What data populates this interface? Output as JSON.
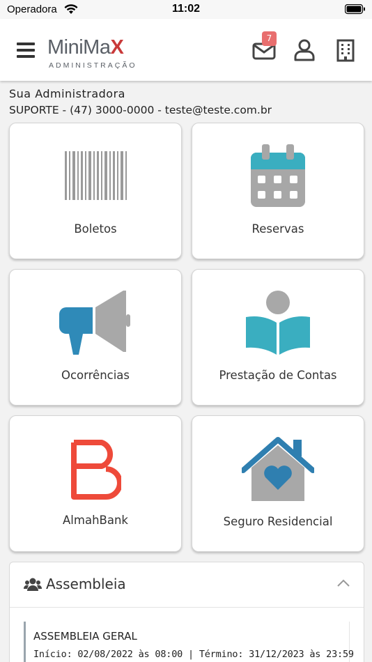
{
  "status_bar": {
    "carrier": "Operadora",
    "time": "11:02"
  },
  "header": {
    "logo_text_main": "MiniMa",
    "logo_text_x": "X",
    "logo_subtext": "ADMINISTRAÇÃO",
    "mail_badge": "7"
  },
  "admin": {
    "name": "Sua Administradora",
    "contact": "SUPORTE - (47) 3000-0000 - teste@teste.com.br"
  },
  "tiles": [
    {
      "label": "Boletos",
      "icon": "barcode-icon"
    },
    {
      "label": "Reservas",
      "icon": "calendar-icon"
    },
    {
      "label": "Ocorrências",
      "icon": "megaphone-icon"
    },
    {
      "label": "Prestação de Contas",
      "icon": "reading-book-icon"
    },
    {
      "label": "AlmahBank",
      "icon": "almahbank-logo-icon"
    },
    {
      "label": "Seguro Residencial",
      "icon": "house-heart-icon"
    }
  ],
  "assembleia": {
    "title": "Assembleia",
    "items": [
      {
        "title": "ASSEMBLEIA GERAL",
        "dates": "Início: 02/08/2022 às 08:00 | Término: 31/12/2023 às 23:59"
      }
    ]
  },
  "colors": {
    "accent_teal": "#3aaec0",
    "accent_blue": "#2f7fb0",
    "almah_red": "#ee4a3a",
    "logo_red": "#c93a3a",
    "icon_gray": "#a8a8a8"
  }
}
